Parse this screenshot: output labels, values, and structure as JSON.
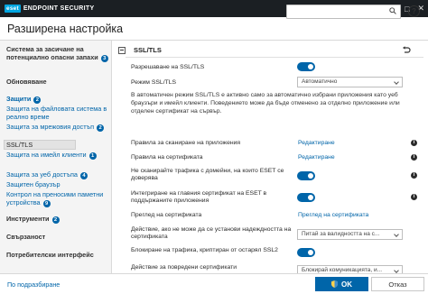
{
  "titlebar": {
    "logo": "eset",
    "product": "ENDPOINT SECURITY",
    "minimize_glyph": "–",
    "maximize_glyph": "□",
    "close_glyph": "✕"
  },
  "header": {
    "title": "Разширена настройка",
    "search_value": "",
    "help_glyph": "?"
  },
  "sidebar": {
    "items": [
      {
        "label": "Система за засичане на потенциално опасни запахи",
        "badge": "3"
      },
      {
        "label": "Обновяване"
      },
      {
        "label": "Защити",
        "badge": "2"
      },
      {
        "label": "Защита на файловата система в реално време"
      },
      {
        "label": "Защита за мрежовия достъп",
        "badge": "2"
      },
      {
        "label": "SSL/TLS"
      },
      {
        "label": "Защита на имейл клиенти",
        "badge": "1"
      },
      {
        "label": "Защита за уеб достъпа",
        "badge": "4"
      },
      {
        "label": "Защитен браузър"
      },
      {
        "label": "Контрол на преносими паметни устройства",
        "badge": "9"
      },
      {
        "label": "Инструменти",
        "badge": "2"
      },
      {
        "label": "Свързаност"
      },
      {
        "label": "Потребителски интерфейс"
      }
    ]
  },
  "section": {
    "title": "SSL/TLS",
    "rows": [
      {
        "label": "Разрешаване на SSL/TLS"
      },
      {
        "label": "Режим SSL/TLS",
        "select": "Автоматично"
      },
      {
        "label": "Правила за сканиране на приложения",
        "link": "Редактиране"
      },
      {
        "label": "Правила на сертификата",
        "link": "Редактиране"
      },
      {
        "label": "Не сканирайте трафика с домейни, на които ESET се доверява"
      },
      {
        "label": "Интегриране на главния сертификат на ESET в поддържаните приложения"
      },
      {
        "label": "Преглед на сертификата",
        "link": "Преглед на сертификата"
      },
      {
        "label": "Действие, ако не може да се установи надеждността на сертификата",
        "select": "Питай за валидността на с..."
      },
      {
        "label": "Блокиране на трафика, криптиран от остарял SSL2"
      },
      {
        "label": "Действие за повредени сертификати",
        "select": "Блокирай комуникацията, и..."
      }
    ],
    "description": "В автоматичен режим SSL/TLS е активно само за автоматично избрани приложения като уеб браузъри и имейл клиенти. Поведението може да бъде отменено за отделно приложение или отделен сертификат на сървър.",
    "info_glyph": "i"
  },
  "footer": {
    "default_label": "По подразбиране",
    "ok_label": "OK",
    "cancel_label": "Отказ"
  },
  "colors": {
    "accent": "#0065a9",
    "titlebar": "#1b1f23",
    "logo_bg": "#00a5e0"
  }
}
